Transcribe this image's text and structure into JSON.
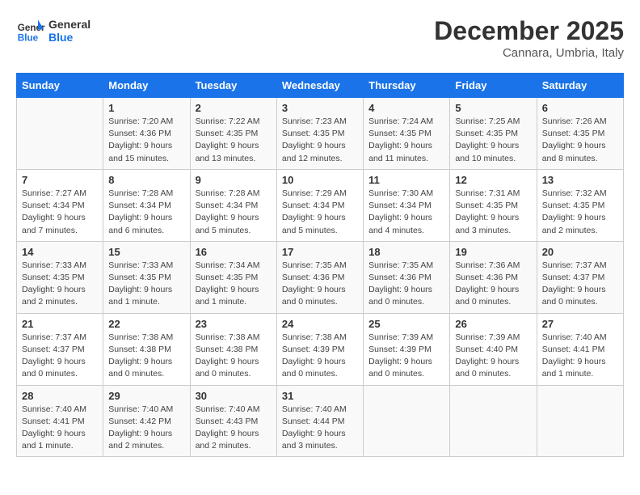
{
  "header": {
    "logo_line1": "General",
    "logo_line2": "Blue",
    "month": "December 2025",
    "location": "Cannara, Umbria, Italy"
  },
  "days_of_week": [
    "Sunday",
    "Monday",
    "Tuesday",
    "Wednesday",
    "Thursday",
    "Friday",
    "Saturday"
  ],
  "weeks": [
    [
      {
        "day": "",
        "info": ""
      },
      {
        "day": "1",
        "info": "Sunrise: 7:20 AM\nSunset: 4:36 PM\nDaylight: 9 hours\nand 15 minutes."
      },
      {
        "day": "2",
        "info": "Sunrise: 7:22 AM\nSunset: 4:35 PM\nDaylight: 9 hours\nand 13 minutes."
      },
      {
        "day": "3",
        "info": "Sunrise: 7:23 AM\nSunset: 4:35 PM\nDaylight: 9 hours\nand 12 minutes."
      },
      {
        "day": "4",
        "info": "Sunrise: 7:24 AM\nSunset: 4:35 PM\nDaylight: 9 hours\nand 11 minutes."
      },
      {
        "day": "5",
        "info": "Sunrise: 7:25 AM\nSunset: 4:35 PM\nDaylight: 9 hours\nand 10 minutes."
      },
      {
        "day": "6",
        "info": "Sunrise: 7:26 AM\nSunset: 4:35 PM\nDaylight: 9 hours\nand 8 minutes."
      }
    ],
    [
      {
        "day": "7",
        "info": "Sunrise: 7:27 AM\nSunset: 4:34 PM\nDaylight: 9 hours\nand 7 minutes."
      },
      {
        "day": "8",
        "info": "Sunrise: 7:28 AM\nSunset: 4:34 PM\nDaylight: 9 hours\nand 6 minutes."
      },
      {
        "day": "9",
        "info": "Sunrise: 7:28 AM\nSunset: 4:34 PM\nDaylight: 9 hours\nand 5 minutes."
      },
      {
        "day": "10",
        "info": "Sunrise: 7:29 AM\nSunset: 4:34 PM\nDaylight: 9 hours\nand 5 minutes."
      },
      {
        "day": "11",
        "info": "Sunrise: 7:30 AM\nSunset: 4:34 PM\nDaylight: 9 hours\nand 4 minutes."
      },
      {
        "day": "12",
        "info": "Sunrise: 7:31 AM\nSunset: 4:35 PM\nDaylight: 9 hours\nand 3 minutes."
      },
      {
        "day": "13",
        "info": "Sunrise: 7:32 AM\nSunset: 4:35 PM\nDaylight: 9 hours\nand 2 minutes."
      }
    ],
    [
      {
        "day": "14",
        "info": "Sunrise: 7:33 AM\nSunset: 4:35 PM\nDaylight: 9 hours\nand 2 minutes."
      },
      {
        "day": "15",
        "info": "Sunrise: 7:33 AM\nSunset: 4:35 PM\nDaylight: 9 hours\nand 1 minute."
      },
      {
        "day": "16",
        "info": "Sunrise: 7:34 AM\nSunset: 4:35 PM\nDaylight: 9 hours\nand 1 minute."
      },
      {
        "day": "17",
        "info": "Sunrise: 7:35 AM\nSunset: 4:36 PM\nDaylight: 9 hours\nand 0 minutes."
      },
      {
        "day": "18",
        "info": "Sunrise: 7:35 AM\nSunset: 4:36 PM\nDaylight: 9 hours\nand 0 minutes."
      },
      {
        "day": "19",
        "info": "Sunrise: 7:36 AM\nSunset: 4:36 PM\nDaylight: 9 hours\nand 0 minutes."
      },
      {
        "day": "20",
        "info": "Sunrise: 7:37 AM\nSunset: 4:37 PM\nDaylight: 9 hours\nand 0 minutes."
      }
    ],
    [
      {
        "day": "21",
        "info": "Sunrise: 7:37 AM\nSunset: 4:37 PM\nDaylight: 9 hours\nand 0 minutes."
      },
      {
        "day": "22",
        "info": "Sunrise: 7:38 AM\nSunset: 4:38 PM\nDaylight: 9 hours\nand 0 minutes."
      },
      {
        "day": "23",
        "info": "Sunrise: 7:38 AM\nSunset: 4:38 PM\nDaylight: 9 hours\nand 0 minutes."
      },
      {
        "day": "24",
        "info": "Sunrise: 7:38 AM\nSunset: 4:39 PM\nDaylight: 9 hours\nand 0 minutes."
      },
      {
        "day": "25",
        "info": "Sunrise: 7:39 AM\nSunset: 4:39 PM\nDaylight: 9 hours\nand 0 minutes."
      },
      {
        "day": "26",
        "info": "Sunrise: 7:39 AM\nSunset: 4:40 PM\nDaylight: 9 hours\nand 0 minutes."
      },
      {
        "day": "27",
        "info": "Sunrise: 7:40 AM\nSunset: 4:41 PM\nDaylight: 9 hours\nand 1 minute."
      }
    ],
    [
      {
        "day": "28",
        "info": "Sunrise: 7:40 AM\nSunset: 4:41 PM\nDaylight: 9 hours\nand 1 minute."
      },
      {
        "day": "29",
        "info": "Sunrise: 7:40 AM\nSunset: 4:42 PM\nDaylight: 9 hours\nand 2 minutes."
      },
      {
        "day": "30",
        "info": "Sunrise: 7:40 AM\nSunset: 4:43 PM\nDaylight: 9 hours\nand 2 minutes."
      },
      {
        "day": "31",
        "info": "Sunrise: 7:40 AM\nSunset: 4:44 PM\nDaylight: 9 hours\nand 3 minutes."
      },
      {
        "day": "",
        "info": ""
      },
      {
        "day": "",
        "info": ""
      },
      {
        "day": "",
        "info": ""
      }
    ]
  ]
}
